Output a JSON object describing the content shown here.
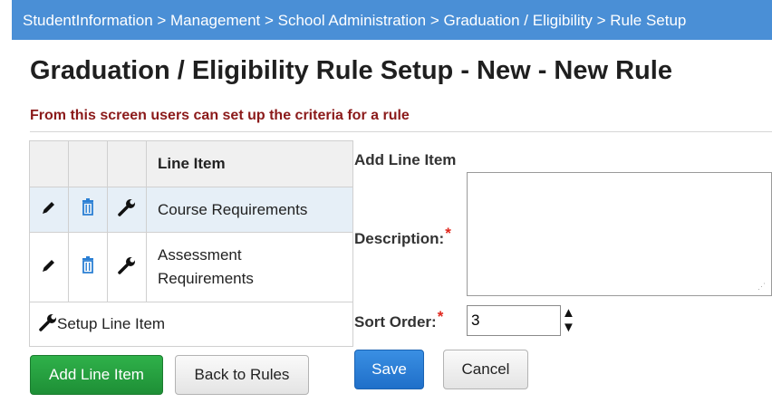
{
  "breadcrumb": "StudentInformation > Management > School Administration > Graduation / Eligibility > Rule Setup",
  "page_title": "Graduation / Eligibility Rule Setup - New - New Rule",
  "subtitle": "From this screen users can set up the criteria for a rule",
  "table": {
    "header": "Line Item",
    "rows": [
      {
        "label": "Course Requirements"
      },
      {
        "label_line1": "Assessment",
        "label_line2": "Requirements"
      }
    ],
    "footer_link": "Setup Line Item"
  },
  "form": {
    "section_label": "Add Line Item",
    "description_label": "Description:",
    "required_mark": "*",
    "description_value": "",
    "sort_order_label": "Sort Order:",
    "sort_order_value": "3"
  },
  "buttons": {
    "add_line_item": "Add Line Item",
    "back_to_rules": "Back to Rules",
    "save": "Save",
    "cancel": "Cancel"
  },
  "icons": {
    "edit": "pencil-icon",
    "delete": "trash-icon",
    "setup": "wrench-icon",
    "spinner_up": "caret-up-icon",
    "spinner_down": "caret-down-icon"
  },
  "colors": {
    "breadcrumb_bg": "#4a8fd6",
    "subtitle": "#8b1a1a",
    "primary_green": "#1e8f36",
    "primary_blue": "#1f6fc9",
    "required": "#e0261c",
    "selected_row": "#e6eff7"
  }
}
